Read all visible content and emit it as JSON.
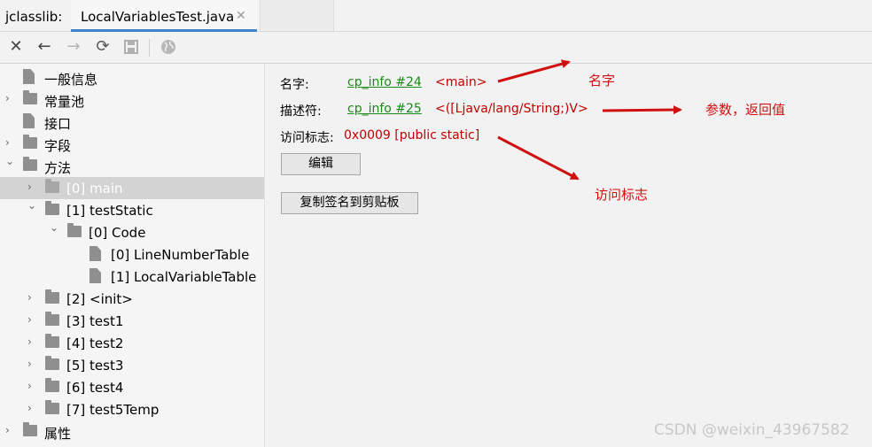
{
  "tabbar": {
    "tool_label": "jclasslib:",
    "active_tab": "LocalVariablesTest.java",
    "close_glyph": "✕"
  },
  "toolbar": {
    "icons": [
      "close-icon",
      "back-icon",
      "forward-icon",
      "refresh-icon",
      "save-icon",
      "browser-icon"
    ]
  },
  "tree": {
    "items": [
      {
        "label": "一般信息",
        "icon": "document-icon",
        "expander": ""
      },
      {
        "label": "常量池",
        "icon": "folder-icon",
        "expander": "›"
      },
      {
        "label": "接口",
        "icon": "document-icon",
        "expander": ""
      },
      {
        "label": "字段",
        "icon": "folder-icon",
        "expander": "›"
      },
      {
        "label": "方法",
        "icon": "folder-icon",
        "expander": "⌄"
      },
      {
        "label": "[0] main",
        "icon": "folder-icon",
        "expander": "›",
        "selected": true
      },
      {
        "label": "[1] testStatic",
        "icon": "folder-icon",
        "expander": "⌄"
      },
      {
        "label": "[0] Code",
        "icon": "folder-icon",
        "expander": "⌄"
      },
      {
        "label": "[0] LineNumberTable",
        "icon": "document-icon",
        "expander": ""
      },
      {
        "label": "[1] LocalVariableTable",
        "icon": "document-icon",
        "expander": ""
      },
      {
        "label": "[2] <init>",
        "icon": "folder-icon",
        "expander": "›"
      },
      {
        "label": "[3] test1",
        "icon": "folder-icon",
        "expander": "›"
      },
      {
        "label": "[4] test2",
        "icon": "folder-icon",
        "expander": "›"
      },
      {
        "label": "[5] test3",
        "icon": "folder-icon",
        "expander": "›"
      },
      {
        "label": "[6] test4",
        "icon": "folder-icon",
        "expander": "›"
      },
      {
        "label": "[7] test5Temp",
        "icon": "folder-icon",
        "expander": "›"
      },
      {
        "label": "属性",
        "icon": "folder-icon",
        "expander": "›"
      }
    ]
  },
  "detail": {
    "name_label": "名字:",
    "name_link": "cp_info #24",
    "name_value": "<main>",
    "descriptor_label": "描述符:",
    "descriptor_link": "cp_info #25",
    "descriptor_value": "<([Ljava/lang/String;)V>",
    "access_label": "访问标志:",
    "access_value": "0x0009 [public static]",
    "edit_button": "编辑",
    "copy_button": "复制签名到剪贴板"
  },
  "annotations": {
    "name": "名字",
    "params": "参数，返回值",
    "access": "访问标志",
    "color": "#d01010"
  },
  "watermark": "CSDN @weixin_43967582"
}
